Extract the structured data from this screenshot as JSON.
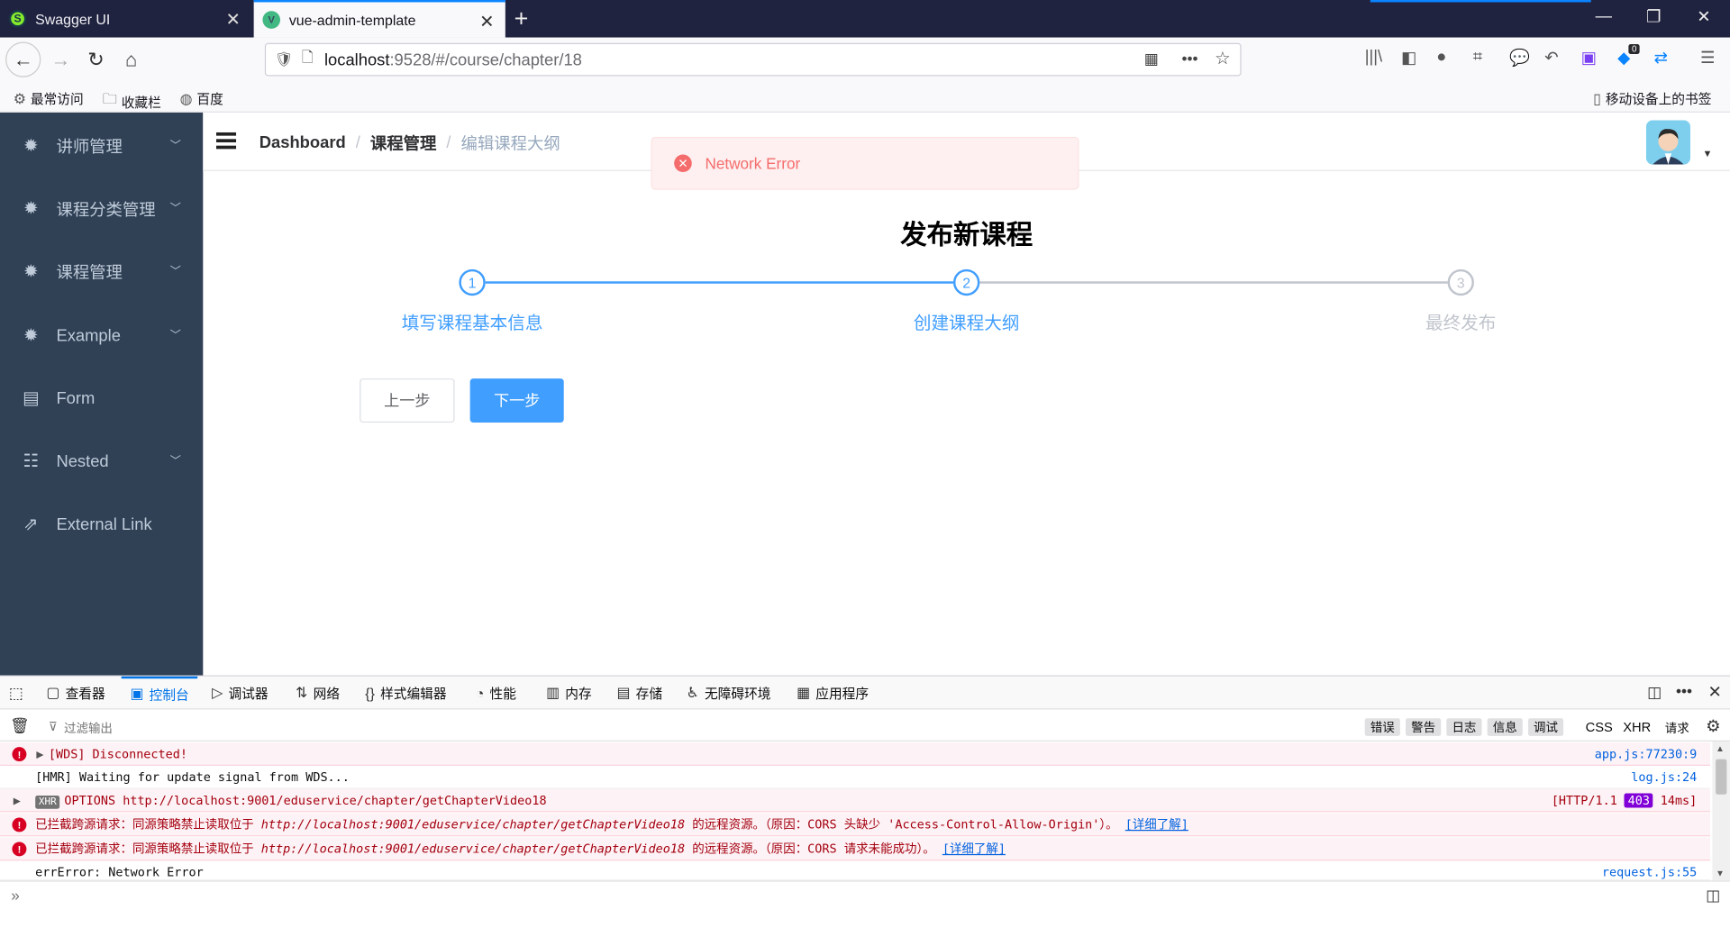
{
  "browser": {
    "tabs": [
      {
        "label": "Swagger UI"
      },
      {
        "label": "vue-admin-template"
      }
    ],
    "url_host": "localhost",
    "url_path": ":9528/#/course/chapter/18",
    "extensions_badge": "0",
    "bookmarks": [
      "最常访问",
      "收藏栏",
      "百度"
    ],
    "mobile_bookmarks": "移动设备上的书签"
  },
  "sidebar": {
    "items": [
      {
        "label": "讲师管理",
        "icon": "gear-icon",
        "has_submenu": true
      },
      {
        "label": "课程分类管理",
        "icon": "gear-icon",
        "has_submenu": true
      },
      {
        "label": "课程管理",
        "icon": "gear-icon",
        "has_submenu": true
      },
      {
        "label": "Example",
        "icon": "gear-icon",
        "has_submenu": true
      },
      {
        "label": "Form",
        "icon": "form-icon",
        "has_submenu": false
      },
      {
        "label": "Nested",
        "icon": "nested-icon",
        "has_submenu": true
      },
      {
        "label": "External Link",
        "icon": "external-link-icon",
        "has_submenu": false
      }
    ],
    "colors": {
      "bg": "#304156",
      "text": "#bfcbd9"
    }
  },
  "header": {
    "breadcrumbs": [
      "Dashboard",
      "课程管理",
      "编辑课程大纲"
    ]
  },
  "toast": {
    "message": "Network Error",
    "color": "#f56c6c"
  },
  "main": {
    "title": "发布新课程",
    "steps": [
      {
        "number": "1",
        "label": "填写课程基本信息",
        "status": "finished"
      },
      {
        "number": "2",
        "label": "创建课程大纲",
        "status": "process"
      },
      {
        "number": "3",
        "label": "最终发布",
        "status": "wait"
      }
    ],
    "prev_button": "上一步",
    "next_button": "下一步",
    "accent": "#409eff"
  },
  "devtools": {
    "tabs": [
      "查看器",
      "控制台",
      "调试器",
      "网络",
      "样式编辑器",
      "性能",
      "内存",
      "存储",
      "无障碍环境",
      "应用程序"
    ],
    "active_tab": "控制台",
    "filter_placeholder": "过滤输出",
    "filter_chips": [
      "错误",
      "警告",
      "日志",
      "信息",
      "调试"
    ],
    "filter_types": [
      "CSS",
      "XHR",
      "请求"
    ],
    "logs": [
      {
        "type": "error",
        "text": "[WDS] Disconnected!",
        "source": "app.js:77230:9"
      },
      {
        "type": "log",
        "text": "[HMR] Waiting for update signal from WDS...",
        "source": "log.js:24"
      },
      {
        "type": "xhr",
        "badge": "XHR",
        "method": "OPTIONS",
        "url": "http://localhost:9001/eduservice/chapter/getChapterVideo18",
        "protocol": "[HTTP/1.1",
        "status": "403",
        "time": "14ms]"
      },
      {
        "type": "error",
        "prefix": "已拦截跨源请求：同源策略禁止读取位于",
        "url": "http://localhost:9001/eduservice/chapter/getChapterVideo18",
        "suffix": "的远程资源。（原因：CORS 头缺少 'Access-Control-Allow-Origin'）。",
        "link": "[详细了解]"
      },
      {
        "type": "error",
        "prefix": "已拦截跨源请求：同源策略禁止读取位于",
        "url": "http://localhost:9001/eduservice/chapter/getChapterVideo18",
        "suffix": "的远程资源。（原因：CORS 请求未能成功）。",
        "link": "[详细了解]"
      },
      {
        "type": "log",
        "text": "errError: Network Error",
        "source": "request.js:55"
      }
    ]
  }
}
